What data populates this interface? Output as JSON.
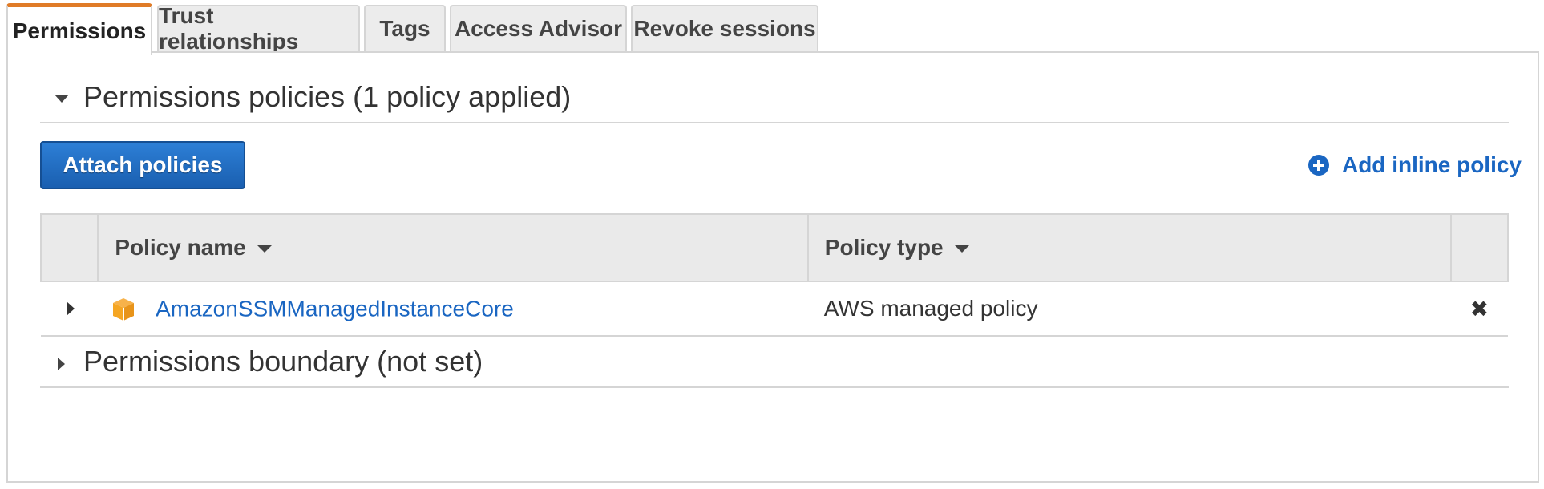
{
  "tabs": [
    {
      "label": "Permissions",
      "active": true
    },
    {
      "label": "Trust relationships",
      "active": false
    },
    {
      "label": "Tags",
      "active": false
    },
    {
      "label": "Access Advisor",
      "active": false
    },
    {
      "label": "Revoke sessions",
      "active": false
    }
  ],
  "permissions_policies": {
    "title": "Permissions policies (1 policy applied)",
    "expanded": true,
    "attach_button": "Attach policies",
    "add_inline_link": "Add inline policy",
    "table": {
      "columns": [
        "Policy name",
        "Policy type"
      ],
      "rows": [
        {
          "name": "AmazonSSMManagedInstanceCore",
          "type": "AWS managed policy",
          "icon": "aws-package-icon"
        }
      ]
    }
  },
  "permissions_boundary": {
    "title": "Permissions boundary (not set)",
    "expanded": false
  },
  "colors": {
    "accent_tab": "#e07b27",
    "primary_button": "#1a5fb0",
    "link": "#1a66c2",
    "policy_icon": "#f5a623"
  }
}
